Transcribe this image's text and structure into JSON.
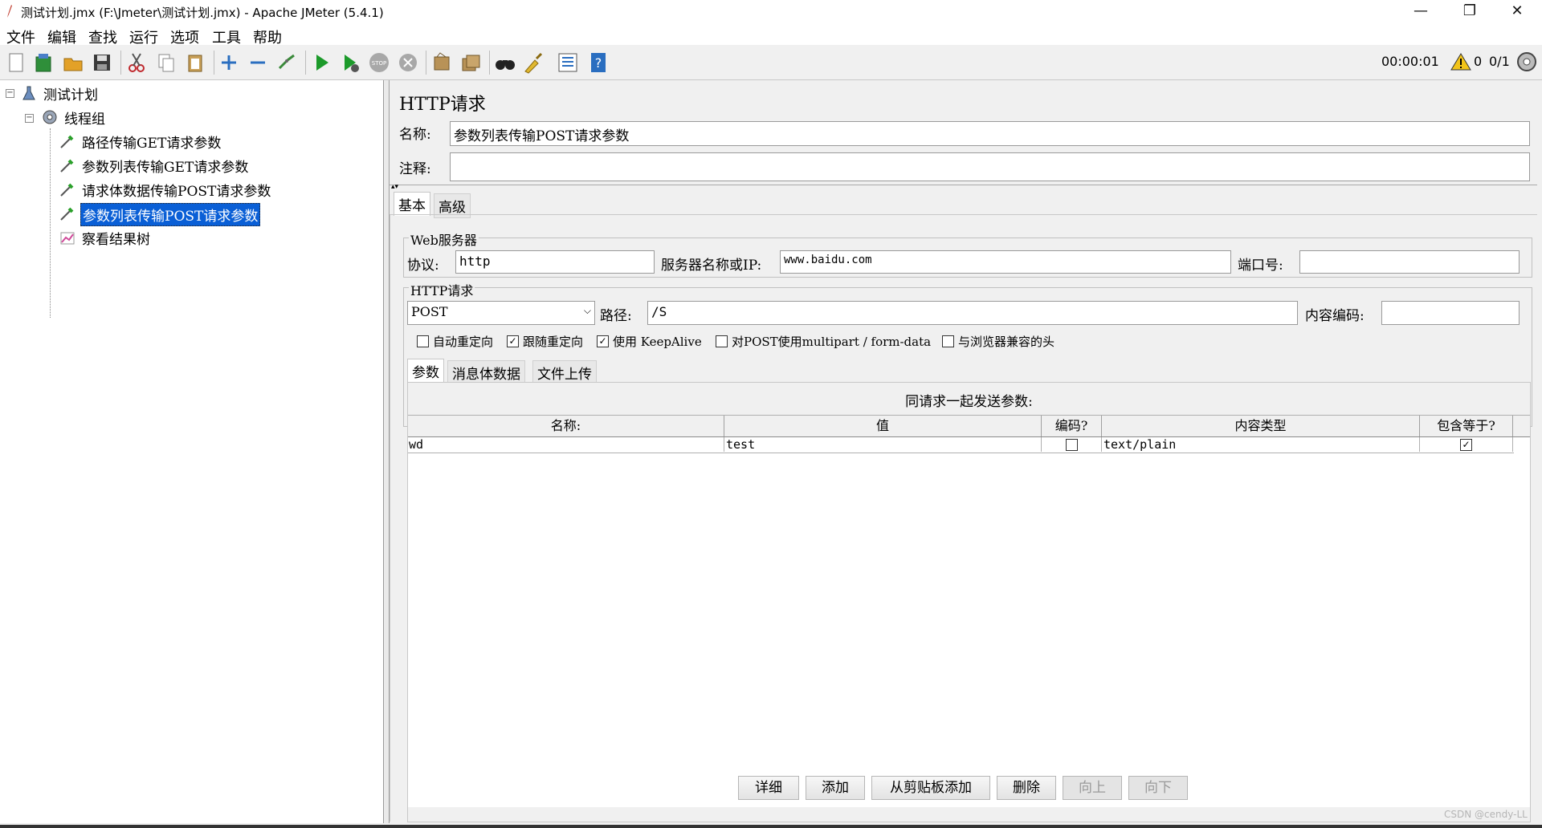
{
  "window": {
    "title": "测试计划.jmx (F:\\Jmeter\\测试计划.jmx) - Apache JMeter (5.4.1)",
    "minimize": "—",
    "maximize": "❐",
    "close": "✕"
  },
  "menu": [
    "文件",
    "编辑",
    "查找",
    "运行",
    "选项",
    "工具",
    "帮助"
  ],
  "status": {
    "timer": "00:00:01",
    "warnings": "0",
    "threads": "0/1"
  },
  "tree": {
    "root": "测试计划",
    "thread_group": "线程组",
    "items": [
      "路径传输GET请求参数",
      "参数列表传输GET请求参数",
      "请求体数据传输POST请求参数",
      "参数列表传输POST请求参数",
      "察看结果树"
    ],
    "selected_index": 3
  },
  "panel": {
    "title": "HTTP请求",
    "name_label": "名称:",
    "name_value": "参数列表传输POST请求参数",
    "comment_label": "注释:",
    "comment_value": "",
    "tabs": [
      "基本",
      "高级"
    ],
    "web_server": {
      "legend": "Web服务器",
      "protocol_label": "协议:",
      "protocol_value": "http",
      "server_label": "服务器名称或IP:",
      "server_value": "www.baidu.com",
      "port_label": "端口号:",
      "port_value": ""
    },
    "http_request": {
      "legend": "HTTP请求",
      "method": "POST",
      "path_label": "路径:",
      "path_value": "/S",
      "encoding_label": "内容编码:",
      "encoding_value": ""
    },
    "checkboxes": [
      {
        "label": "自动重定向",
        "checked": false
      },
      {
        "label": "跟随重定向",
        "checked": true
      },
      {
        "label": "使用 KeepAlive",
        "checked": true
      },
      {
        "label": "对POST使用multipart / form-data",
        "checked": false
      },
      {
        "label": "与浏览器兼容的头",
        "checked": false
      }
    ],
    "subtabs": [
      "参数",
      "消息体数据",
      "文件上传"
    ],
    "params_caption": "同请求一起发送参数:",
    "table": {
      "headers": [
        "名称:",
        "值",
        "编码?",
        "内容类型",
        "包含等于?"
      ],
      "rows": [
        {
          "name": "wd",
          "value": "test",
          "encode": false,
          "content_type": "text/plain",
          "include_equals": true
        }
      ]
    },
    "buttons": [
      "详细",
      "添加",
      "从剪贴板添加",
      "删除",
      "向上",
      "向下"
    ]
  },
  "watermark": "CSDN @cendy-LL"
}
